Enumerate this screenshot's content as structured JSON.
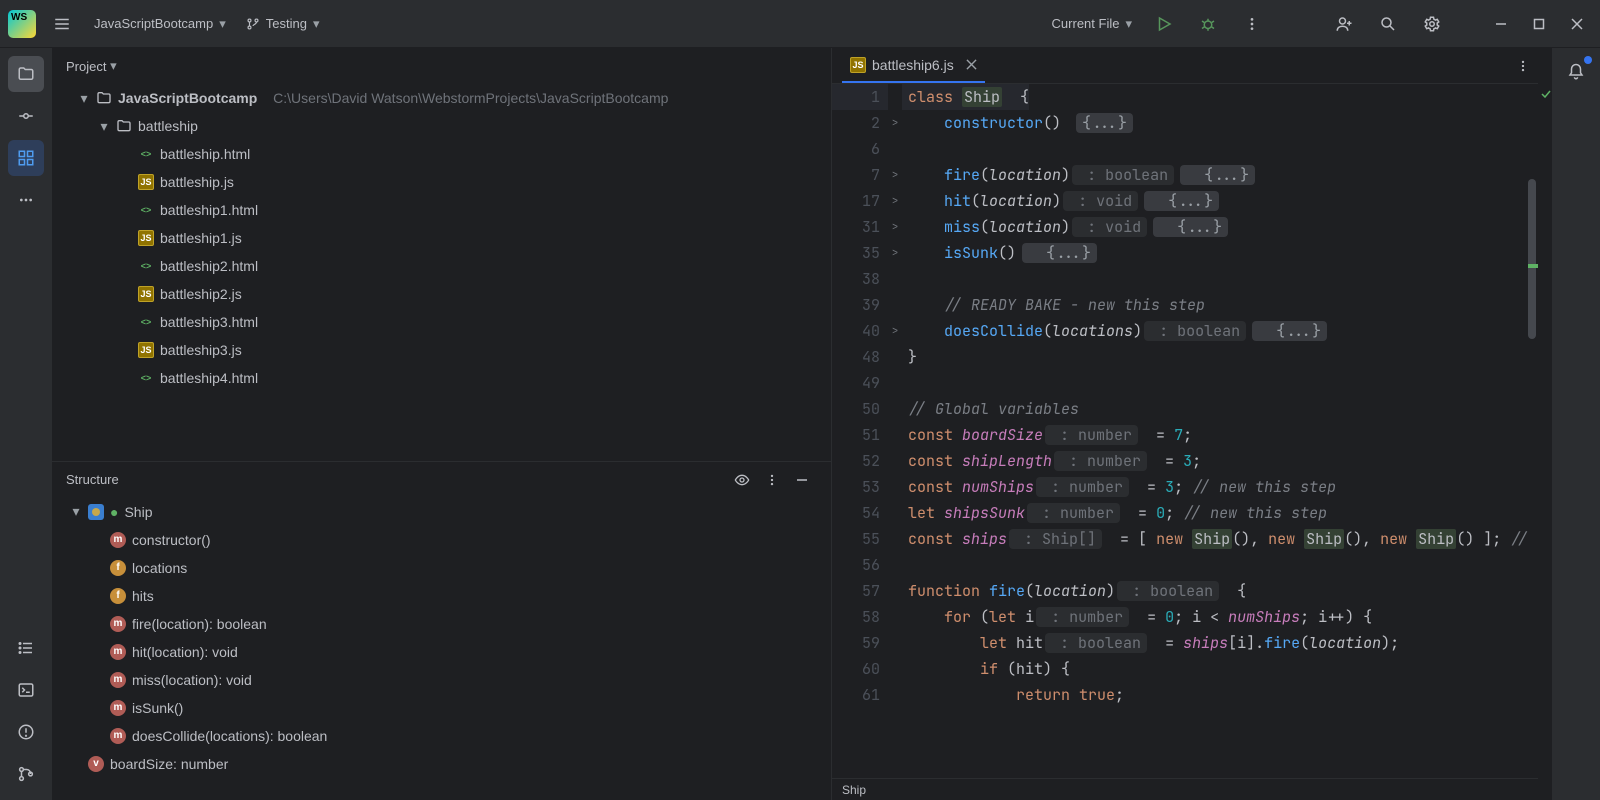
{
  "titlebar": {
    "project_name": "JavaScriptBootcamp",
    "branch": "Testing",
    "run_config": "Current File"
  },
  "project": {
    "pane_title": "Project",
    "root_name": "JavaScriptBootcamp",
    "root_path": "C:\\Users\\David Watson\\WebstormProjects\\JavaScriptBootcamp",
    "folder": "battleship",
    "files": [
      {
        "name": "battleship.html",
        "kind": "html"
      },
      {
        "name": "battleship.js",
        "kind": "js"
      },
      {
        "name": "battleship1.html",
        "kind": "html"
      },
      {
        "name": "battleship1.js",
        "kind": "js"
      },
      {
        "name": "battleship2.html",
        "kind": "html"
      },
      {
        "name": "battleship2.js",
        "kind": "js"
      },
      {
        "name": "battleship3.html",
        "kind": "html"
      },
      {
        "name": "battleship3.js",
        "kind": "js"
      },
      {
        "name": "battleship4.html",
        "kind": "html"
      }
    ]
  },
  "structure": {
    "pane_title": "Structure",
    "class_name": "Ship",
    "members": [
      {
        "kind": "m",
        "label": "constructor()"
      },
      {
        "kind": "f",
        "label": "locations"
      },
      {
        "kind": "f",
        "label": "hits"
      },
      {
        "kind": "m",
        "label": "fire(location): boolean"
      },
      {
        "kind": "m",
        "label": "hit(location): void"
      },
      {
        "kind": "m",
        "label": "miss(location): void"
      },
      {
        "kind": "m",
        "label": "isSunk()"
      },
      {
        "kind": "m",
        "label": "doesCollide(locations): boolean"
      }
    ],
    "global": "boardSize: number"
  },
  "editor": {
    "tab_name": "battleship6.js",
    "status": "Ship",
    "lines": [
      {
        "n": 1,
        "tokens": [
          [
            "kw",
            "class "
          ],
          [
            "cls",
            "Ship"
          ],
          [
            "",
            "  {"
          ]
        ],
        "hl": true
      },
      {
        "n": 2,
        "fold": ">",
        "tokens": [
          [
            "",
            "    "
          ],
          [
            "fn",
            "constructor"
          ],
          [
            "",
            "() "
          ],
          [
            "pill",
            "{...}"
          ]
        ]
      },
      {
        "n": 6,
        "tokens": [
          [
            "",
            ""
          ]
        ]
      },
      {
        "n": 7,
        "fold": ">",
        "tokens": [
          [
            "",
            "    "
          ],
          [
            "fn",
            "fire"
          ],
          [
            "",
            "("
          ],
          [
            "param",
            "location"
          ],
          [
            "",
            ")"
          ],
          [
            "hint",
            " : boolean"
          ],
          [
            "pill",
            "  {...}"
          ]
        ]
      },
      {
        "n": 17,
        "fold": ">",
        "tokens": [
          [
            "",
            "    "
          ],
          [
            "fn",
            "hit"
          ],
          [
            "",
            "("
          ],
          [
            "param",
            "location"
          ],
          [
            "",
            ")"
          ],
          [
            "hint",
            " : void"
          ],
          [
            "pill",
            "  {...}"
          ]
        ]
      },
      {
        "n": 31,
        "fold": ">",
        "tokens": [
          [
            "",
            "    "
          ],
          [
            "fn",
            "miss"
          ],
          [
            "",
            "("
          ],
          [
            "param",
            "location"
          ],
          [
            "",
            ")"
          ],
          [
            "hint",
            " : void"
          ],
          [
            "pill",
            "  {...}"
          ]
        ]
      },
      {
        "n": 35,
        "fold": ">",
        "tokens": [
          [
            "",
            "    "
          ],
          [
            "fn",
            "isSunk"
          ],
          [
            "",
            "()"
          ],
          [
            "pill",
            "  {...}"
          ]
        ]
      },
      {
        "n": 38,
        "tokens": [
          [
            "",
            ""
          ]
        ]
      },
      {
        "n": 39,
        "tokens": [
          [
            "",
            "    "
          ],
          [
            "cmt",
            "// READY BAKE - new this step"
          ]
        ]
      },
      {
        "n": 40,
        "fold": ">",
        "tokens": [
          [
            "",
            "    "
          ],
          [
            "fn",
            "doesCollide"
          ],
          [
            "",
            "("
          ],
          [
            "param",
            "locations"
          ],
          [
            "",
            ")"
          ],
          [
            "hint",
            " : boolean"
          ],
          [
            "pill",
            "  {...}"
          ]
        ]
      },
      {
        "n": 48,
        "tokens": [
          [
            "",
            "}"
          ]
        ]
      },
      {
        "n": 49,
        "tokens": [
          [
            "",
            ""
          ]
        ]
      },
      {
        "n": 50,
        "tokens": [
          [
            "cmt",
            "// Global variables"
          ]
        ]
      },
      {
        "n": 51,
        "tokens": [
          [
            "kw",
            "const "
          ],
          [
            "fld",
            "boardSize"
          ],
          [
            "hint",
            " : number"
          ],
          [
            "",
            "  = "
          ],
          [
            "num",
            "7"
          ],
          [
            "",
            ";"
          ]
        ]
      },
      {
        "n": 52,
        "tokens": [
          [
            "kw",
            "const "
          ],
          [
            "fld",
            "shipLength"
          ],
          [
            "hint",
            " : number"
          ],
          [
            "",
            "  = "
          ],
          [
            "num",
            "3"
          ],
          [
            "",
            ";"
          ]
        ]
      },
      {
        "n": 53,
        "tokens": [
          [
            "kw",
            "const "
          ],
          [
            "fld",
            "numShips"
          ],
          [
            "hint",
            " : number"
          ],
          [
            "",
            "  = "
          ],
          [
            "num",
            "3"
          ],
          [
            "",
            "; "
          ],
          [
            "cmt",
            "// new this step"
          ]
        ]
      },
      {
        "n": 54,
        "tokens": [
          [
            "kw",
            "let "
          ],
          [
            "fld",
            "shipsSunk"
          ],
          [
            "hint",
            " : number"
          ],
          [
            "",
            "  = "
          ],
          [
            "num",
            "0"
          ],
          [
            "",
            "; "
          ],
          [
            "cmt",
            "// new this step"
          ]
        ]
      },
      {
        "n": 55,
        "tokens": [
          [
            "kw",
            "const "
          ],
          [
            "fld",
            "ships"
          ],
          [
            "hint",
            " : Ship[]"
          ],
          [
            "",
            "  = [ "
          ],
          [
            "kw",
            "new "
          ],
          [
            "cls",
            "Ship"
          ],
          [
            "",
            "(), "
          ],
          [
            "kw",
            "new "
          ],
          [
            "cls",
            "Ship"
          ],
          [
            "",
            "(), "
          ],
          [
            "kw",
            "new "
          ],
          [
            "cls",
            "Ship"
          ],
          [
            "",
            "() ]; "
          ],
          [
            "cmt",
            "//"
          ]
        ]
      },
      {
        "n": 56,
        "tokens": [
          [
            "",
            ""
          ]
        ]
      },
      {
        "n": 57,
        "tokens": [
          [
            "kw",
            "function "
          ],
          [
            "fn",
            "fire"
          ],
          [
            "",
            "("
          ],
          [
            "param",
            "location"
          ],
          [
            "",
            ")"
          ],
          [
            "hint",
            " : boolean"
          ],
          [
            "",
            "  {"
          ]
        ]
      },
      {
        "n": 58,
        "tokens": [
          [
            "",
            "    "
          ],
          [
            "kw",
            "for"
          ],
          [
            "",
            " ("
          ],
          [
            "kw",
            "let"
          ],
          [
            "",
            " i"
          ],
          [
            "hint",
            " : number"
          ],
          [
            "",
            "  = "
          ],
          [
            "num",
            "0"
          ],
          [
            "",
            "; i < "
          ],
          [
            "fld",
            "numShips"
          ],
          [
            "",
            "; i++) {"
          ]
        ]
      },
      {
        "n": 59,
        "tokens": [
          [
            "",
            "        "
          ],
          [
            "kw",
            "let"
          ],
          [
            "",
            " hit"
          ],
          [
            "hint",
            " : boolean"
          ],
          [
            "",
            "  = "
          ],
          [
            "fld",
            "ships"
          ],
          [
            "",
            "[i]."
          ],
          [
            "fn",
            "fire"
          ],
          [
            "",
            "("
          ],
          [
            "param",
            "location"
          ],
          [
            "",
            ");"
          ]
        ]
      },
      {
        "n": 60,
        "tokens": [
          [
            "",
            "        "
          ],
          [
            "kw",
            "if"
          ],
          [
            "",
            " (hit) {"
          ]
        ]
      },
      {
        "n": 61,
        "tokens": [
          [
            "",
            "            "
          ],
          [
            "kw",
            "return "
          ],
          [
            "kw",
            "true"
          ],
          [
            "",
            ";"
          ]
        ]
      }
    ]
  }
}
